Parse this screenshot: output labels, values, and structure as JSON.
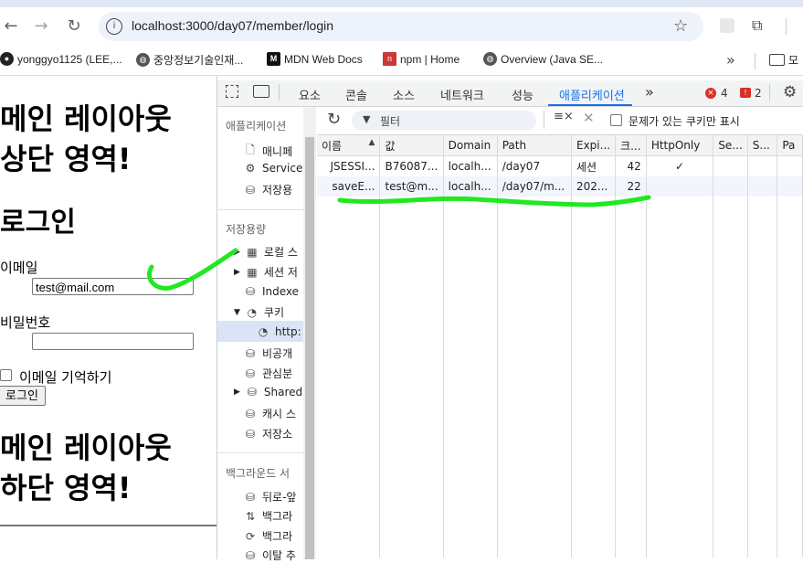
{
  "browser": {
    "url": "localhost:3000/day07/member/login",
    "bookmarks": [
      {
        "label": "yonggyo1125 (LEE,...",
        "icon": "github-icon"
      },
      {
        "label": "중앙정보기술인재...",
        "icon": "globe-icon"
      },
      {
        "label": "MDN Web Docs",
        "icon": "mdn-icon"
      },
      {
        "label": "npm | Home",
        "icon": "npm-icon"
      },
      {
        "label": "Overview (Java SE...",
        "icon": "globe-icon"
      }
    ],
    "bookmark_overflow": "»",
    "bookmark_folder": "모"
  },
  "page": {
    "header_line1": "메인 레이아웃",
    "header_line2": "상단 영역!",
    "title": "로그인",
    "email_label": "이메일",
    "email_value": "test@mail.com",
    "password_label": "비밀번호",
    "password_value": "",
    "remember_label": "이메일 기억하기",
    "login_button": "로그인",
    "footer_line1": "메인 레이아웃",
    "footer_line2": "하단 영역!"
  },
  "devtools": {
    "tabs": [
      "요소",
      "콘솔",
      "소스",
      "네트워크",
      "성능",
      "애플리케이션"
    ],
    "active_tab": "애플리케이션",
    "more": "»",
    "error_count": "4",
    "issue_count": "2",
    "sidebar": {
      "app_header": "애플리케이션",
      "app_items": [
        "매니페",
        "Service",
        "저장용"
      ],
      "storage_header": "저장용량",
      "storage_items": [
        "로컬 스",
        "세션 저",
        "Indexe",
        "쿠키",
        "http:",
        "비공개",
        "관심분",
        "Shared",
        "캐시 스",
        "저장소"
      ],
      "bg_header": "백그라운드 서",
      "bg_items": [
        "뒤로-앞",
        "백그라",
        "백그라",
        "이탈 추"
      ]
    },
    "filter": {
      "placeholder": "필터",
      "issues_only_label": "문제가 있는 쿠키만 표시"
    },
    "columns": [
      "이름",
      "값",
      "Domain",
      "Path",
      "Expi...",
      "크...",
      "HttpOnly",
      "Se...",
      "S...",
      "Pa"
    ],
    "rows": [
      [
        "JSESSI...",
        "B76087...",
        "localh...",
        "/day07",
        "세션",
        "42",
        "✓",
        "",
        "",
        ""
      ],
      [
        "saveE...",
        "test@m...",
        "localh...",
        "/day07/m...",
        "202...",
        "22",
        "",
        "",
        "",
        ""
      ]
    ]
  },
  "annotation": {
    "color": "#22e822"
  }
}
